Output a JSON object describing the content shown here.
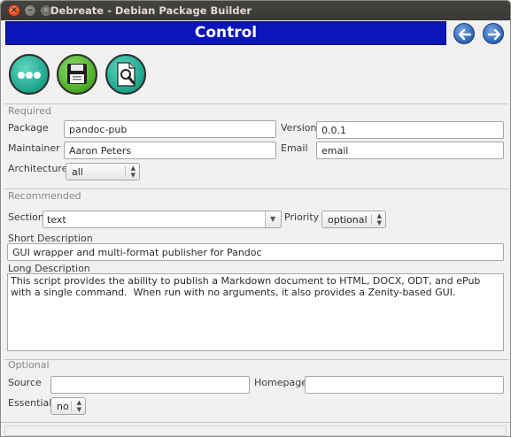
{
  "window": {
    "title": "Debreate - Debian Package Builder",
    "buttons": {
      "close": "×",
      "minimize": "–",
      "maximize": "□"
    }
  },
  "banner": {
    "title": "Control"
  },
  "nav": {
    "back_icon": "left-arrow-icon",
    "forward_icon": "right-arrow-icon"
  },
  "toolbar": {
    "items": [
      {
        "icon": "more-options-icon",
        "color": "#1fa88e"
      },
      {
        "icon": "save-disk-icon",
        "color": "#4cae2a"
      },
      {
        "icon": "preview-document-icon",
        "color": "#1fa88e"
      }
    ]
  },
  "required": {
    "heading": "Required",
    "package_label": "Package",
    "package_value": "pandoc-pub",
    "version_label": "Version",
    "version_value": "0.0.1",
    "maintainer_label": "Maintainer",
    "maintainer_value": "Aaron Peters",
    "email_label": "Email",
    "email_value": "email",
    "architecture_label": "Architecture",
    "architecture_value": "all"
  },
  "recommended": {
    "heading": "Recommended",
    "section_label": "Section",
    "section_value": "text",
    "priority_label": "Priority",
    "priority_value": "optional",
    "short_desc_label": "Short Description",
    "short_desc_value": "GUI wrapper and multi-format publisher for Pandoc",
    "long_desc_label": "Long Description",
    "long_desc_value": "This script provides the ability to publish a Markdown document to HTML, DOCX, ODT, and ePub with a single command.  When run with no arguments, it also provides a Zenity-based GUI."
  },
  "optional": {
    "heading": "Optional",
    "source_label": "Source",
    "source_value": "",
    "homepage_label": "Homepage",
    "homepage_value": "",
    "essential_label": "Essential",
    "essential_value": "no"
  },
  "colors": {
    "banner": "#0b15b8",
    "titlebar": "#3c3b37",
    "teal_button": "#1fa88e",
    "green_button": "#4cae2a"
  }
}
